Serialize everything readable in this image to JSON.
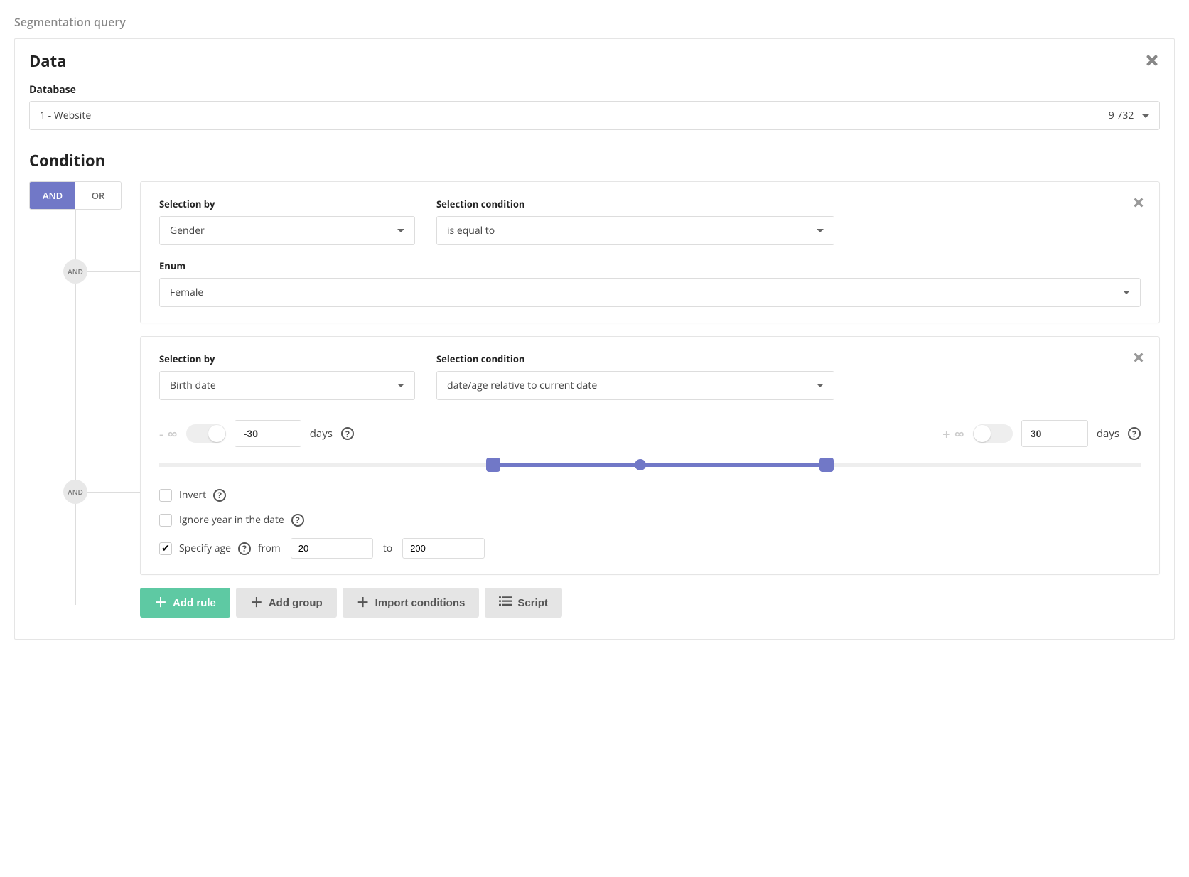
{
  "page_title": "Segmentation query",
  "data_section": {
    "title": "Data",
    "database_label": "Database",
    "database_value": "1 - Website",
    "database_count": "9 732"
  },
  "condition_section": {
    "title": "Condition",
    "logic": {
      "and": "AND",
      "or": "OR",
      "active": "AND"
    },
    "node_label": "AND"
  },
  "rule1": {
    "selection_by_label": "Selection by",
    "selection_by_value": "Gender",
    "condition_label": "Selection condition",
    "condition_value": "is equal to",
    "enum_label": "Enum",
    "enum_value": "Female"
  },
  "rule2": {
    "selection_by_label": "Selection by",
    "selection_by_value": "Birth date",
    "condition_label": "Selection condition",
    "condition_value": "date/age relative to current date",
    "neg_inf": "- ∞",
    "pos_inf": "+ ∞",
    "from_value": "-30",
    "to_value": "30",
    "unit": "days",
    "invert_label": "Invert",
    "ignore_year_label": "Ignore year in the date",
    "specify_age_label": "Specify age",
    "from_word": "from",
    "to_word": "to",
    "age_from": "20",
    "age_to": "200",
    "slider": {
      "left_pct": 34,
      "right_pct": 68,
      "center_pct": 49
    }
  },
  "buttons": {
    "add_rule": "Add rule",
    "add_group": "Add group",
    "import": "Import conditions",
    "script": "Script"
  }
}
